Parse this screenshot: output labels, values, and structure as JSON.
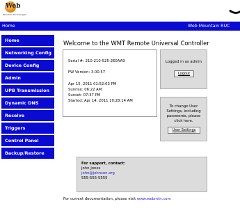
{
  "app": {
    "home_label": "Home",
    "brand_label": "Web Mountain RUC",
    "logo_text": "Web",
    "logo_tagline": "Mountain Technologies"
  },
  "nav": {
    "items": [
      {
        "label": "Home"
      },
      {
        "label": "Networking Config"
      },
      {
        "label": "Device Config"
      },
      {
        "label": "Admin"
      },
      {
        "label": "UPB Transmission"
      },
      {
        "label": "Dynamic DNS"
      },
      {
        "label": "Receive"
      },
      {
        "label": "Triggers"
      },
      {
        "label": "Control Panel"
      },
      {
        "label": "Backup/Restore"
      }
    ]
  },
  "main": {
    "welcome": "Welcome to the WMT Remote Universal Controller",
    "serial": "Serial #: 210-210-525-2E0AA9",
    "fw": "FW Version: 3.00.57",
    "datetime": "Apr 15, 2011 01:52:03 PM",
    "sunrise": "Sunrise: 06:22 AM",
    "sunset": "Sunset: 07:37 PM",
    "started": "Started: Apr 14, 2011 10:28:14 AM"
  },
  "login": {
    "status": "Logged in as admin",
    "logout_label": "Logout"
  },
  "users": {
    "line1": "To change User",
    "line2": "Settings, including",
    "line3": "passwords, please",
    "line4": "click here.",
    "button_label": "User Settings"
  },
  "support": {
    "heading": "For support, contact:",
    "name": "John Jones",
    "email": "john@johnson.org",
    "phone": "555-555-5555"
  },
  "footer": {
    "text": "For current documentation, please visit ",
    "link": "www.webmtn.com"
  }
}
